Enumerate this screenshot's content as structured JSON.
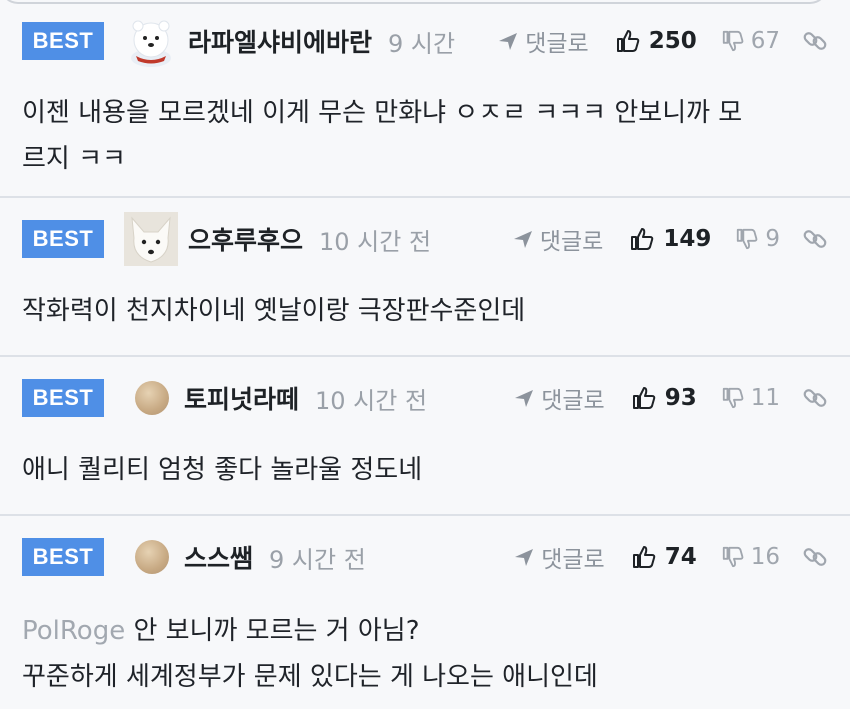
{
  "badge_label": "BEST",
  "reply_label": "댓글로",
  "comments": [
    {
      "nickname": "라파엘샤비에바란",
      "time": "9 시간",
      "likes": "250",
      "dislikes": "67",
      "avatar": "polar-bear-avatar",
      "lines": [
        "이젠 내용을 모르겠네 이게 무슨 만화냐 ㅇㅈㄹ ㅋㅋㅋ 안보니까 모",
        "르지 ㅋㅋ"
      ]
    },
    {
      "nickname": "으후루후으",
      "time": "10 시간 전",
      "likes": "149",
      "dislikes": "9",
      "avatar": "white-fox-avatar",
      "lines": [
        "작화력이 천지차이네 옛날이랑 극장판수준인데"
      ]
    },
    {
      "nickname": "토피넛라떼",
      "time": "10 시간 전",
      "likes": "93",
      "dislikes": "11",
      "avatar": "beige-dot-avatar",
      "lines": [
        "애니 퀄리티 엄청 좋다 놀라울 정도네"
      ]
    },
    {
      "nickname": "스스쌤",
      "time": "9 시간 전",
      "likes": "74",
      "dislikes": "16",
      "avatar": "beige-dot-avatar",
      "mention": "PolRoge",
      "lines": [
        " 안 보니까 모르는 거 아님?",
        "꾸준하게 세계정부가 문제 있다는 게 나오는 애니인데"
      ]
    }
  ],
  "colors": {
    "badge": "#4f8fe6",
    "background": "#f7f8fa",
    "muted": "#9aa0a8",
    "mention": "#a2a8b0"
  }
}
